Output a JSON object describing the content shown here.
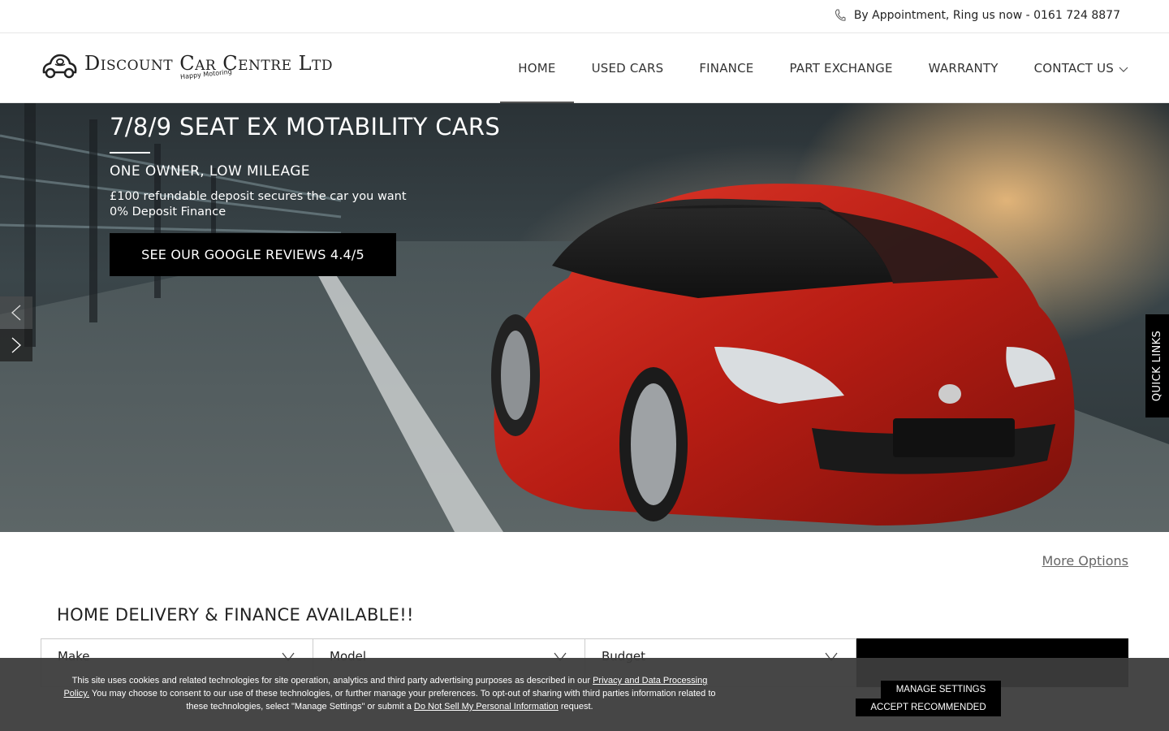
{
  "topbar": {
    "phone_text": "By Appointment, Ring us now - 0161 724 8877",
    "icon": "phone-icon"
  },
  "header": {
    "logo_text": "Discount Car Centre Ltd",
    "logo_tagline": "Happy Motoring",
    "nav": [
      {
        "label": "HOME",
        "active": true
      },
      {
        "label": "USED CARS"
      },
      {
        "label": "FINANCE"
      },
      {
        "label": "PART EXCHANGE"
      },
      {
        "label": "WARRANTY"
      },
      {
        "label": "CONTACT US",
        "dropdown": true
      }
    ]
  },
  "hero": {
    "title": "7/8/9 SEAT EX MOTABILITY CARS",
    "subtitle": "ONE OWNER, LOW MILEAGE",
    "line1": "£100 refundable deposit secures the car you want",
    "line2": "0% Deposit Finance",
    "button_label": "SEE OUR GOOGLE REVIEWS 4.4/5"
  },
  "quick_links": "QUICK LINKS",
  "more_options": "More Options",
  "search": {
    "title": "HOME DELIVERY & FINANCE AVAILABLE!!",
    "make": "Make",
    "model": "Model",
    "budget": "Budget"
  },
  "cookie": {
    "text1": "This site uses cookies and related technologies for site operation, analytics and third party advertising purposes as described in our ",
    "link1": "Privacy and Data Processing Policy.",
    "text2": " You may choose to consent to our use of these technologies, or further manage your preferences. To opt-out of sharing with third parties information related to these technologies, select \"Manage Settings\" or submit a ",
    "link2": "Do Not Sell My Personal Information",
    "text3": " request.",
    "manage_label": "MANAGE SETTINGS",
    "accept_label": "ACCEPT RECOMMENDED"
  },
  "colors": {
    "accent": "#000000",
    "car": "#c0201a",
    "cookie_bg": "#3c3c3c"
  }
}
